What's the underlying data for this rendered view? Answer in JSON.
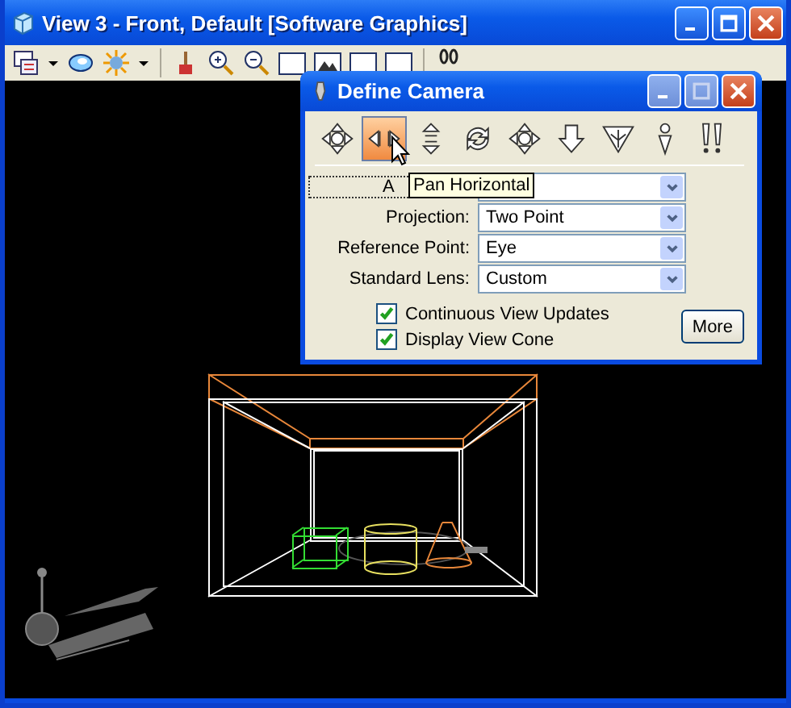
{
  "window": {
    "title": "View 3 - Front, Default [Software Graphics]"
  },
  "dialog": {
    "title": "Define Camera",
    "tools": [
      {
        "selected": false
      },
      {
        "selected": true
      },
      {
        "selected": false
      },
      {
        "selected": false
      },
      {
        "selected": false
      },
      {
        "selected": false
      },
      {
        "selected": false
      },
      {
        "selected": false
      },
      {
        "selected": false
      }
    ],
    "tooltip": "Pan Horizontal",
    "fields": [
      {
        "label": "A"
      },
      {
        "label": "Projection:",
        "value": "Two Point"
      },
      {
        "label": "Reference Point:",
        "value": "Eye"
      },
      {
        "label": "Standard Lens:",
        "value": "Custom"
      }
    ],
    "checkboxes": [
      {
        "label": "Continuous View Updates",
        "checked": true
      },
      {
        "label": "Display View Cone",
        "checked": true
      }
    ],
    "button": "More"
  }
}
